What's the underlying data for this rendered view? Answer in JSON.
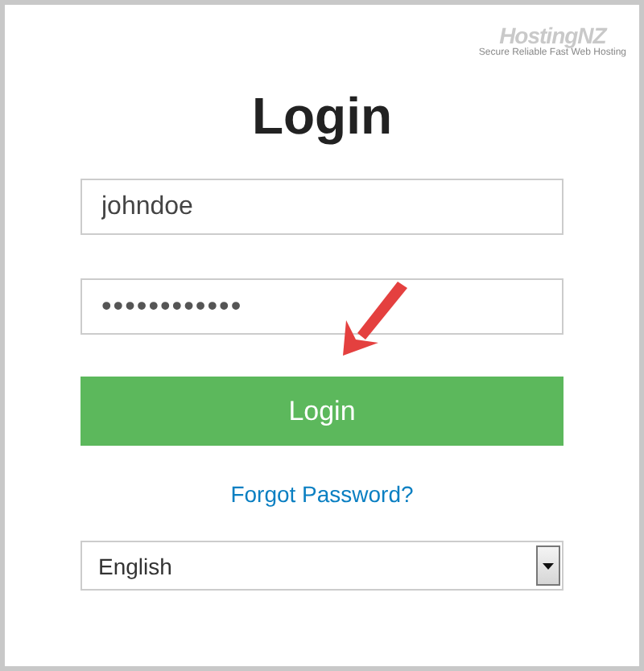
{
  "logo": {
    "name": "HostingNZ",
    "tagline": "Secure Reliable Fast Web Hosting"
  },
  "title": "Login",
  "username": {
    "value": "johndoe"
  },
  "password": {
    "value": "••••••••••••"
  },
  "login_button": "Login",
  "forgot_link": "Forgot Password?",
  "language": {
    "value": "English"
  }
}
